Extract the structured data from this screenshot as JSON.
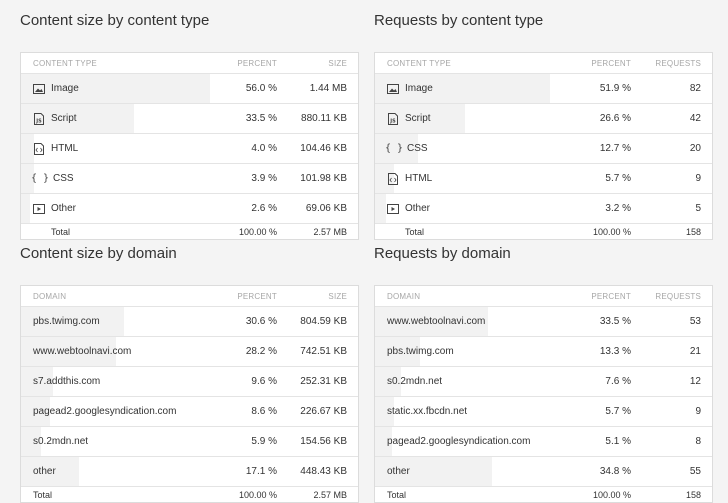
{
  "panels": {
    "size_by_type": {
      "title": "Content size by content type",
      "headers": [
        "CONTENT TYPE",
        "PERCENT",
        "SIZE"
      ],
      "rows": [
        {
          "label": "Image",
          "icon": "image-icon",
          "percent": "56.0 %",
          "value": "1.44 MB",
          "share": 0.56
        },
        {
          "label": "Script",
          "icon": "script-icon",
          "percent": "33.5 %",
          "value": "880.11 KB",
          "share": 0.335
        },
        {
          "label": "HTML",
          "icon": "html-file-icon",
          "percent": "4.0 %",
          "value": "104.46 KB",
          "share": 0.04
        },
        {
          "label": "CSS",
          "icon": "css-braces-icon",
          "percent": "3.9 %",
          "value": "101.98 KB",
          "share": 0.039
        },
        {
          "label": "Other",
          "icon": "other-media-icon",
          "percent": "2.6 %",
          "value": "69.06 KB",
          "share": 0.026
        }
      ],
      "total": {
        "label": "Total",
        "percent": "100.00 %",
        "value": "2.57 MB"
      }
    },
    "requests_by_type": {
      "title": "Requests by content type",
      "headers": [
        "CONTENT TYPE",
        "PERCENT",
        "REQUESTS"
      ],
      "rows": [
        {
          "label": "Image",
          "icon": "image-icon",
          "percent": "51.9 %",
          "value": "82",
          "share": 0.519
        },
        {
          "label": "Script",
          "icon": "script-icon",
          "percent": "26.6 %",
          "value": "42",
          "share": 0.266
        },
        {
          "label": "CSS",
          "icon": "css-braces-icon",
          "percent": "12.7 %",
          "value": "20",
          "share": 0.127
        },
        {
          "label": "HTML",
          "icon": "html-file-icon",
          "percent": "5.7 %",
          "value": "9",
          "share": 0.057
        },
        {
          "label": "Other",
          "icon": "other-media-icon",
          "percent": "3.2 %",
          "value": "5",
          "share": 0.032
        }
      ],
      "total": {
        "label": "Total",
        "percent": "100.00 %",
        "value": "158"
      }
    },
    "size_by_domain": {
      "title": "Content size by domain",
      "headers": [
        "DOMAIN",
        "PERCENT",
        "SIZE"
      ],
      "rows": [
        {
          "label": "pbs.twimg.com",
          "percent": "30.6 %",
          "value": "804.59 KB",
          "share": 0.306
        },
        {
          "label": "www.webtoolnavi.com",
          "percent": "28.2 %",
          "value": "742.51 KB",
          "share": 0.282
        },
        {
          "label": "s7.addthis.com",
          "percent": "9.6 %",
          "value": "252.31 KB",
          "share": 0.096
        },
        {
          "label": "pagead2.googlesyndication.com",
          "percent": "8.6 %",
          "value": "226.67 KB",
          "share": 0.086
        },
        {
          "label": "s0.2mdn.net",
          "percent": "5.9 %",
          "value": "154.56 KB",
          "share": 0.059
        },
        {
          "label": "other",
          "percent": "17.1 %",
          "value": "448.43 KB",
          "share": 0.171
        }
      ],
      "total": {
        "label": "Total",
        "percent": "100.00 %",
        "value": "2.57 MB"
      }
    },
    "requests_by_domain": {
      "title": "Requests by domain",
      "headers": [
        "DOMAIN",
        "PERCENT",
        "REQUESTS"
      ],
      "rows": [
        {
          "label": "www.webtoolnavi.com",
          "percent": "33.5 %",
          "value": "53",
          "share": 0.335
        },
        {
          "label": "pbs.twimg.com",
          "percent": "13.3 %",
          "value": "21",
          "share": 0.133
        },
        {
          "label": "s0.2mdn.net",
          "percent": "7.6 %",
          "value": "12",
          "share": 0.076
        },
        {
          "label": "static.xx.fbcdn.net",
          "percent": "5.7 %",
          "value": "9",
          "share": 0.057
        },
        {
          "label": "pagead2.googlesyndication.com",
          "percent": "5.1 %",
          "value": "8",
          "share": 0.051
        },
        {
          "label": "other",
          "percent": "34.8 %",
          "value": "55",
          "share": 0.348
        }
      ],
      "total": {
        "label": "Total",
        "percent": "100.00 %",
        "value": "158"
      }
    }
  },
  "colors": {
    "bar": "#f2f2f2",
    "border": "#dcdcdc",
    "header_text": "#a7a7a7"
  }
}
